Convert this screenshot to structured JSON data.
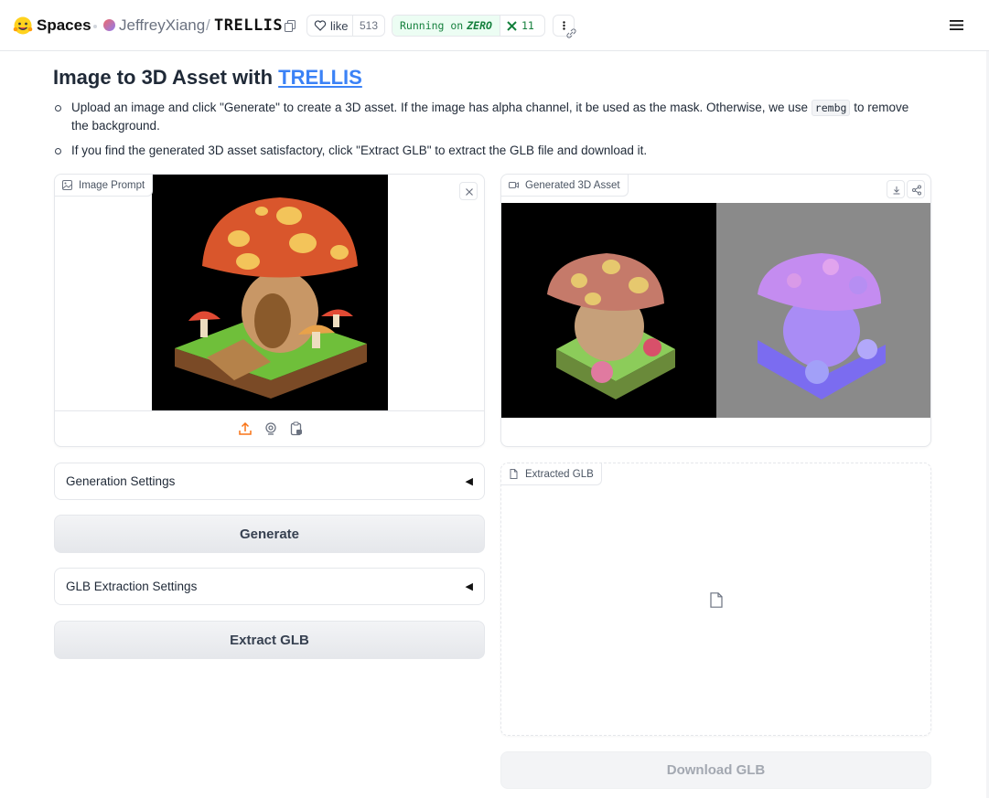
{
  "topbar": {
    "spaces_label": "Spaces",
    "owner": "JeffreyXiang",
    "slash": "/",
    "repo": "TRELLIS",
    "like_label": "like",
    "like_count": "513",
    "running_label": "Running on",
    "running_hw": "ZERO",
    "hw_count": "11"
  },
  "page": {
    "title_prefix": "Image to 3D Asset with",
    "title_link": "TRELLIS",
    "bullet1_before": "Upload an image and click \"Generate\" to create a 3D asset. If the image has alpha channel, it be used as the mask. Otherwise, we use",
    "bullet1_code": "rembg",
    "bullet1_after": "to remove the background.",
    "bullet2": "If you find the generated 3D asset satisfactory, click \"Extract GLB\" to extract the GLB file and download it."
  },
  "image_prompt": {
    "label": "Image Prompt"
  },
  "generated_asset": {
    "label": "Generated 3D Asset"
  },
  "generation_settings": {
    "label": "Generation Settings",
    "arrow": "◀"
  },
  "generate_button": {
    "label": "Generate"
  },
  "glb_settings": {
    "label": "GLB Extraction Settings",
    "arrow": "◀"
  },
  "extract_button": {
    "label": "Extract GLB"
  },
  "extracted_glb": {
    "label": "Extracted GLB"
  },
  "download_button": {
    "label": "Download GLB"
  },
  "colors": {
    "link": "#3b82f6",
    "running_green": "#15803d",
    "upload_orange": "#f97316"
  }
}
